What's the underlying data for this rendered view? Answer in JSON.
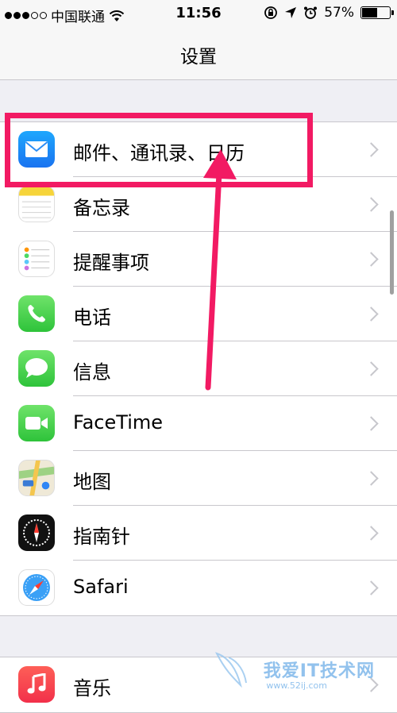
{
  "status_bar": {
    "carrier": "中国联通",
    "time": "11:56",
    "battery_percent": "57%",
    "battery_level": 0.57
  },
  "nav": {
    "title": "设置"
  },
  "group1": [
    {
      "label": "邮件、通讯录、日历",
      "icon": "mail-icon"
    },
    {
      "label": "备忘录",
      "icon": "notes-icon"
    },
    {
      "label": "提醒事项",
      "icon": "reminders-icon"
    },
    {
      "label": "电话",
      "icon": "phone-icon"
    },
    {
      "label": "信息",
      "icon": "messages-icon"
    },
    {
      "label": "FaceTime",
      "icon": "facetime-icon"
    },
    {
      "label": "地图",
      "icon": "maps-icon"
    },
    {
      "label": "指南针",
      "icon": "compass-icon"
    },
    {
      "label": "Safari",
      "icon": "safari-icon"
    }
  ],
  "group2": [
    {
      "label": "音乐",
      "icon": "music-icon"
    }
  ],
  "watermark": {
    "text": "我爱IT技术网",
    "url": "www.52ij.com"
  },
  "colors": {
    "highlight": "#f21a63",
    "arrow": "#f21a63"
  }
}
